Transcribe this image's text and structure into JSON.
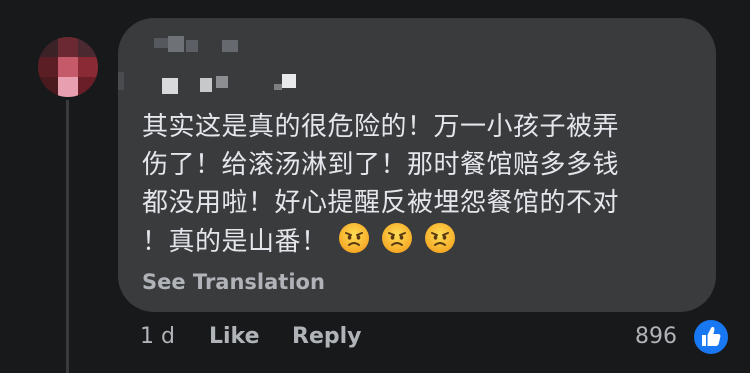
{
  "comment": {
    "text": "其实这是真的很危险的！万一小孩子被弄伤了！给滚汤淋到了！那时餐馆赔多多钱都没用啦！好心提醒反被埋怨餐馆的不对！真的是山番！",
    "line1": "其实这是真的很危险的！万一小孩子被弄",
    "line2": "伤了！给滚汤淋到了！那时餐馆赔多多钱",
    "line3": "都没用啦！好心提醒反被埋怨餐馆的不对",
    "line4": "！真的是山番！",
    "emojis": [
      "angry-face-icon",
      "angry-face-icon",
      "angry-face-icon"
    ],
    "see_translation": "See Translation"
  },
  "actions": {
    "timestamp": "1 d",
    "like_label": "Like",
    "reply_label": "Reply",
    "reaction_count": "896",
    "reaction_icon": "thumbs-up-icon"
  },
  "colors": {
    "background": "#18191a",
    "bubble": "#3a3b3c",
    "text": "#e4e6eb",
    "secondary": "#b0b3b8",
    "like_blue": "#1877f2"
  }
}
